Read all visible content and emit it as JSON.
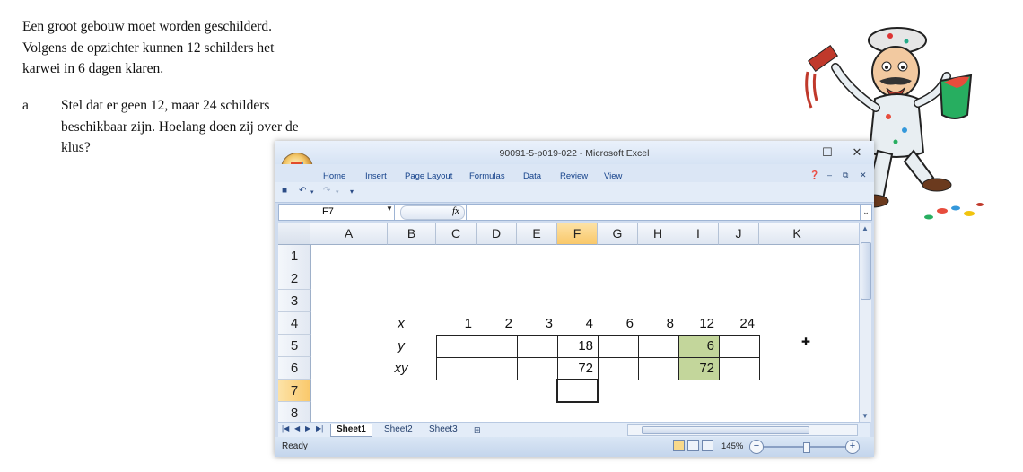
{
  "document": {
    "intro_lines": [
      "Een groot gebouw moet worden geschilderd.",
      "Volgens de opzichter kunnen 12 schilders het",
      "karwei in 6 dagen klaren."
    ],
    "question_label": "a",
    "question_lines": [
      "Stel dat er geen 12, maar 24 schilders",
      "beschikbaar zijn. Hoelang doen zij over de",
      "klus?"
    ]
  },
  "excel": {
    "window_title": "90091-5-p019-022 - Microsoft Excel",
    "window_controls": [
      "–",
      "☐",
      "✕"
    ],
    "ribbon_tabs": [
      "Home",
      "Insert",
      "Page Layout",
      "Formulas",
      "Data",
      "Review",
      "View"
    ],
    "name_box": "F7",
    "fx_label": "fx",
    "columns": [
      "A",
      "B",
      "C",
      "D",
      "E",
      "F",
      "G",
      "H",
      "I",
      "J",
      "K"
    ],
    "selected_column": "F",
    "rows": [
      "1",
      "2",
      "3",
      "4",
      "5",
      "6",
      "7",
      "8"
    ],
    "selected_row": "7",
    "table": {
      "row_labels": [
        "x",
        "y",
        "xy"
      ],
      "x_values": [
        "1",
        "2",
        "3",
        "4",
        "6",
        "8",
        "12",
        "24"
      ],
      "y_values": [
        "",
        "",
        "",
        "18",
        "",
        "",
        "6",
        ""
      ],
      "xy_values": [
        "",
        "",
        "",
        "72",
        "",
        "",
        "72",
        ""
      ]
    },
    "highlight_color": "#c3d69b",
    "sheet_tabs": [
      "Sheet1",
      "Sheet2",
      "Sheet3"
    ],
    "active_sheet": "Sheet1",
    "status": "Ready",
    "zoom": "145%"
  },
  "icons": [
    "office-button-icon",
    "save-icon",
    "undo-icon",
    "redo-icon",
    "help-icon",
    "painter-illustration",
    "cell-cursor-icon"
  ]
}
